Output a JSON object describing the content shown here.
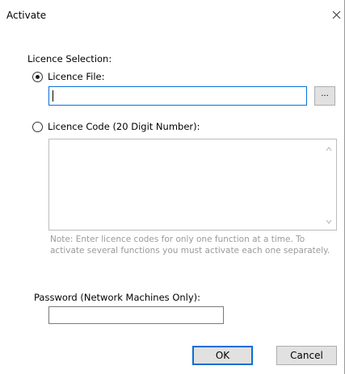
{
  "window": {
    "title": "Activate",
    "close_glyph": "×"
  },
  "licence_selection": {
    "heading": "Licence Selection:",
    "file_option": {
      "label": "Licence File:",
      "selected": true,
      "value": "",
      "browse_label": "..."
    },
    "code_option": {
      "label": "Licence Code (20 Digit Number):",
      "selected": false,
      "value": ""
    },
    "note": "Note: Enter licence codes for only one function at a time. To activate several functions you must activate each one separately."
  },
  "password": {
    "label": "Password (Network Machines Only):",
    "value": ""
  },
  "buttons": {
    "ok_label": "OK",
    "cancel_label": "Cancel"
  },
  "colors": {
    "focus_border": "#0a6fd6",
    "button_face": "#e1e1e1",
    "disabled_text": "#9a9a9a"
  }
}
